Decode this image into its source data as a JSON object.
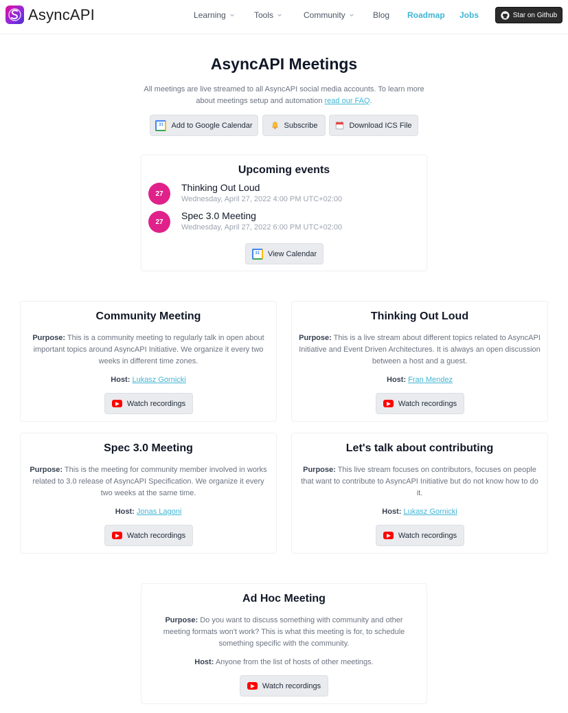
{
  "nav": {
    "logo_text": "AsyncAPI",
    "items": [
      {
        "label": "Learning",
        "dropdown": true
      },
      {
        "label": "Tools",
        "dropdown": true
      },
      {
        "label": "Community",
        "dropdown": true
      },
      {
        "label": "Blog",
        "dropdown": false
      },
      {
        "label": "Roadmap",
        "dropdown": false,
        "active": true
      },
      {
        "label": "Jobs",
        "dropdown": false,
        "active": true
      }
    ],
    "github_label": "Star on Github"
  },
  "header": {
    "title": "AsyncAPI Meetings",
    "intro": "All meetings are live streamed to all AsyncAPI social media accounts. To learn more about meetings setup and automation ",
    "faq_link": "read our FAQ",
    "intro_end": ".",
    "buttons": {
      "google": "Add to Google Calendar",
      "subscribe": "Subscribe",
      "ics": "Download ICS File"
    }
  },
  "upcoming": {
    "title": "Upcoming events",
    "events": [
      {
        "day": "27",
        "name": "Thinking Out Loud",
        "date": "Wednesday, April 27, 2022 4:00 PM UTC+02:00"
      },
      {
        "day": "27",
        "name": "Spec 3.0 Meeting",
        "date": "Wednesday, April 27, 2022 6:00 PM UTC+02:00"
      }
    ],
    "view_calendar": "View Calendar"
  },
  "meetings": [
    {
      "title": "Community Meeting",
      "purpose_label": "Purpose:",
      "purpose": " This is a community meeting to regularly talk in open about important topics around AsyncAPI Initiative. We organize it every two weeks in different time zones.",
      "host_label": "Host:",
      "host": "Lukasz Gornicki",
      "recordings": "Watch recordings"
    },
    {
      "title": "Thinking Out Loud",
      "purpose_label": "Purpose:",
      "purpose": " This is a live stream about different topics related to AsyncAPI Initiative and Event Driven Architectures. It is always an open discussion between a host and a guest.",
      "host_label": "Host:",
      "host": "Fran Mendez",
      "recordings": "Watch recordings"
    },
    {
      "title": "Spec 3.0 Meeting",
      "purpose_label": "Purpose:",
      "purpose": " This is the meeting for community member involved in works related to 3.0 release of AsyncAPI Specification. We organize it every two weeks at the same time.",
      "host_label": "Host:",
      "host": "Jonas Lagoni",
      "recordings": "Watch recordings"
    },
    {
      "title": "Let's talk about contributing",
      "purpose_label": "Purpose:",
      "purpose": " This live stream focuses on contributors, focuses on people that want to contribute to AsyncAPI Initiative but do not know how to do it.",
      "host_label": "Host:",
      "host": "Lukasz Gornicki",
      "recordings": "Watch recordings"
    },
    {
      "title": "Ad Hoc Meeting",
      "purpose_label": "Purpose:",
      "purpose": " Do you want to discuss something with community and other meeting formats won't work? This is what this meeting is for, to schedule something specific with the community.",
      "host_label": "Host:",
      "host_plain": " Anyone from the list of hosts of other meetings.",
      "recordings": "Watch recordings"
    }
  ],
  "colors": {
    "accent": "#3fb5d4",
    "badge": "#e0218a",
    "youtube": "#ff0000"
  }
}
